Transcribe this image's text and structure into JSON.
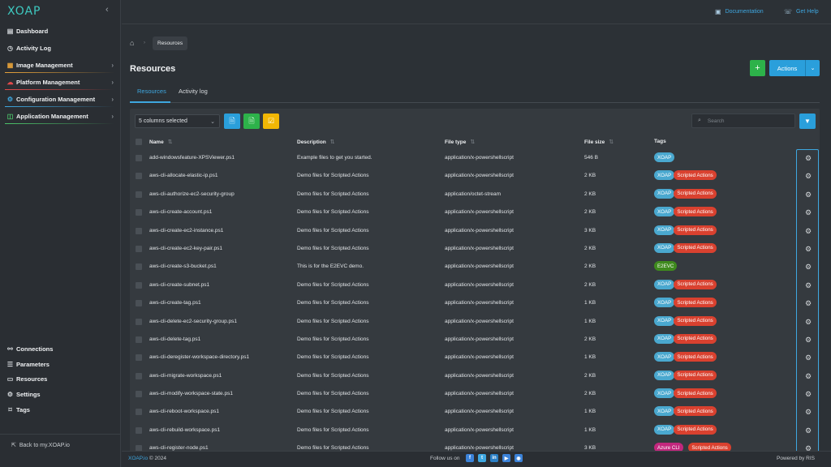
{
  "app": {
    "logo_text": "XOAP"
  },
  "sidebar": {
    "items": [
      {
        "label": "Dashboard",
        "icon": "dashboard-icon",
        "has_chevron": false
      },
      {
        "label": "Activity Log",
        "icon": "clock-icon",
        "has_chevron": false
      },
      {
        "label": "Image Management",
        "icon": "image-icon",
        "has_chevron": true,
        "accent": "#e8a33a"
      },
      {
        "label": "Platform Management",
        "icon": "cloud-icon",
        "has_chevron": true,
        "accent": "#e24a4a"
      },
      {
        "label": "Configuration Management",
        "icon": "config-icon",
        "has_chevron": true,
        "accent": "#3ea7e0"
      },
      {
        "label": "Application Management",
        "icon": "apps-icon",
        "has_chevron": true,
        "accent": "#4cc46a"
      }
    ],
    "bottom_items": [
      {
        "label": "Connections",
        "icon": "link-icon"
      },
      {
        "label": "Parameters",
        "icon": "list-icon"
      },
      {
        "label": "Resources",
        "icon": "folder-icon"
      },
      {
        "label": "Settings",
        "icon": "gear-icon"
      },
      {
        "label": "Tags",
        "icon": "tag-icon"
      }
    ],
    "back_link": "Back to my.XOAP.io"
  },
  "topbar": {
    "documentation": "Documentation",
    "get_help": "Get Help"
  },
  "breadcrumb": {
    "current": "Resources"
  },
  "page": {
    "title": "Resources",
    "actions_label": "Actions",
    "add_label": "+"
  },
  "tabs": [
    {
      "label": "Resources",
      "active": true
    },
    {
      "label": "Activity log",
      "active": false
    }
  ],
  "toolbar": {
    "columns_selected": "5 columns selected",
    "search_placeholder": "Search"
  },
  "table": {
    "columns": [
      "Name",
      "Description",
      "File type",
      "File size",
      "Tags"
    ],
    "rows": [
      {
        "name": "add-windowsfeature-XPSViewer.ps1",
        "description": "Example files to get you started.",
        "file_type": "application/x-powershellscript",
        "file_size": "546 B",
        "tags": [
          "XOAP"
        ]
      },
      {
        "name": "aws-cli-allocate-elastic-ip.ps1",
        "description": "Demo files for Scripted Actions",
        "file_type": "application/x-powershellscript",
        "file_size": "2 KB",
        "tags": [
          "XOAP",
          "Scripted Actions"
        ]
      },
      {
        "name": "aws-cli-authorize-ec2-security-group",
        "description": "Demo files for Scripted Actions",
        "file_type": "application/octet-stream",
        "file_size": "2 KB",
        "tags": [
          "XOAP",
          "Scripted Actions"
        ]
      },
      {
        "name": "aws-cli-create-account.ps1",
        "description": "Demo files for Scripted Actions",
        "file_type": "application/x-powershellscript",
        "file_size": "2 KB",
        "tags": [
          "XOAP",
          "Scripted Actions"
        ]
      },
      {
        "name": "aws-cli-create-ec2-instance.ps1",
        "description": "Demo files for Scripted Actions",
        "file_type": "application/x-powershellscript",
        "file_size": "3 KB",
        "tags": [
          "XOAP",
          "Scripted Actions"
        ]
      },
      {
        "name": "aws-cli-create-ec2-key-pair.ps1",
        "description": "Demo files for Scripted Actions",
        "file_type": "application/x-powershellscript",
        "file_size": "2 KB",
        "tags": [
          "XOAP",
          "Scripted Actions"
        ]
      },
      {
        "name": "aws-cli-create-s3-bucket.ps1",
        "description": "This is for the E2EVC demo.",
        "file_type": "application/x-powershellscript",
        "file_size": "2 KB",
        "tags": [
          "E2EVC"
        ]
      },
      {
        "name": "aws-cli-create-subnet.ps1",
        "description": "Demo files for Scripted Actions",
        "file_type": "application/x-powershellscript",
        "file_size": "2 KB",
        "tags": [
          "XOAP",
          "Scripted Actions"
        ]
      },
      {
        "name": "aws-cli-create-tag.ps1",
        "description": "Demo files for Scripted Actions",
        "file_type": "application/x-powershellscript",
        "file_size": "1 KB",
        "tags": [
          "XOAP",
          "Scripted Actions"
        ]
      },
      {
        "name": "aws-cli-delete-ec2-security-group.ps1",
        "description": "Demo files for Scripted Actions",
        "file_type": "application/x-powershellscript",
        "file_size": "1 KB",
        "tags": [
          "XOAP",
          "Scripted Actions"
        ]
      },
      {
        "name": "aws-cli-delete-tag.ps1",
        "description": "Demo files for Scripted Actions",
        "file_type": "application/x-powershellscript",
        "file_size": "2 KB",
        "tags": [
          "XOAP",
          "Scripted Actions"
        ]
      },
      {
        "name": "aws-cli-deregister-workspace-directory.ps1",
        "description": "Demo files for Scripted Actions",
        "file_type": "application/x-powershellscript",
        "file_size": "1 KB",
        "tags": [
          "XOAP",
          "Scripted Actions"
        ]
      },
      {
        "name": "aws-cli-migrate-workspace.ps1",
        "description": "Demo files for Scripted Actions",
        "file_type": "application/x-powershellscript",
        "file_size": "2 KB",
        "tags": [
          "XOAP",
          "Scripted Actions"
        ]
      },
      {
        "name": "aws-cli-modify-workspace-state.ps1",
        "description": "Demo files for Scripted Actions",
        "file_type": "application/x-powershellscript",
        "file_size": "2 KB",
        "tags": [
          "XOAP",
          "Scripted Actions"
        ]
      },
      {
        "name": "aws-cli-reboot-workspace.ps1",
        "description": "Demo files for Scripted Actions",
        "file_type": "application/x-powershellscript",
        "file_size": "1 KB",
        "tags": [
          "XOAP",
          "Scripted Actions"
        ]
      },
      {
        "name": "aws-cli-rebuild-workspace.ps1",
        "description": "Demo files for Scripted Actions",
        "file_type": "application/x-powershellscript",
        "file_size": "1 KB",
        "tags": [
          "XOAP",
          "Scripted Actions"
        ]
      },
      {
        "name": "aws-cli-register-node.ps1",
        "description": "Demo files for Scripted Actions",
        "file_type": "application/x-powershellscript",
        "file_size": "3 KB",
        "tags": [
          "Azure CLI",
          "Scripted Actions"
        ]
      }
    ]
  },
  "tag_colors": {
    "XOAP": "#4aa8cf",
    "Scripted Actions": "#d9412f",
    "E2EVC": "#3f8a1e",
    "Azure CLI": "#c2277d"
  },
  "footer": {
    "brand": "XOAP.io",
    "copyright": "© 2024",
    "follow_us": "Follow us on",
    "social": [
      {
        "icon": "facebook-icon",
        "glyph": "f",
        "color": "#3b82d8"
      },
      {
        "icon": "twitter-icon",
        "glyph": "t",
        "color": "#3ea7e0"
      },
      {
        "icon": "linkedin-icon",
        "glyph": "in",
        "color": "#2a7fc6"
      },
      {
        "icon": "youtube-icon",
        "glyph": "▶",
        "color": "#3b82d8"
      },
      {
        "icon": "github-icon",
        "glyph": "◉",
        "color": "#3b82d8"
      }
    ],
    "powered_by": "Powered by RIS"
  }
}
